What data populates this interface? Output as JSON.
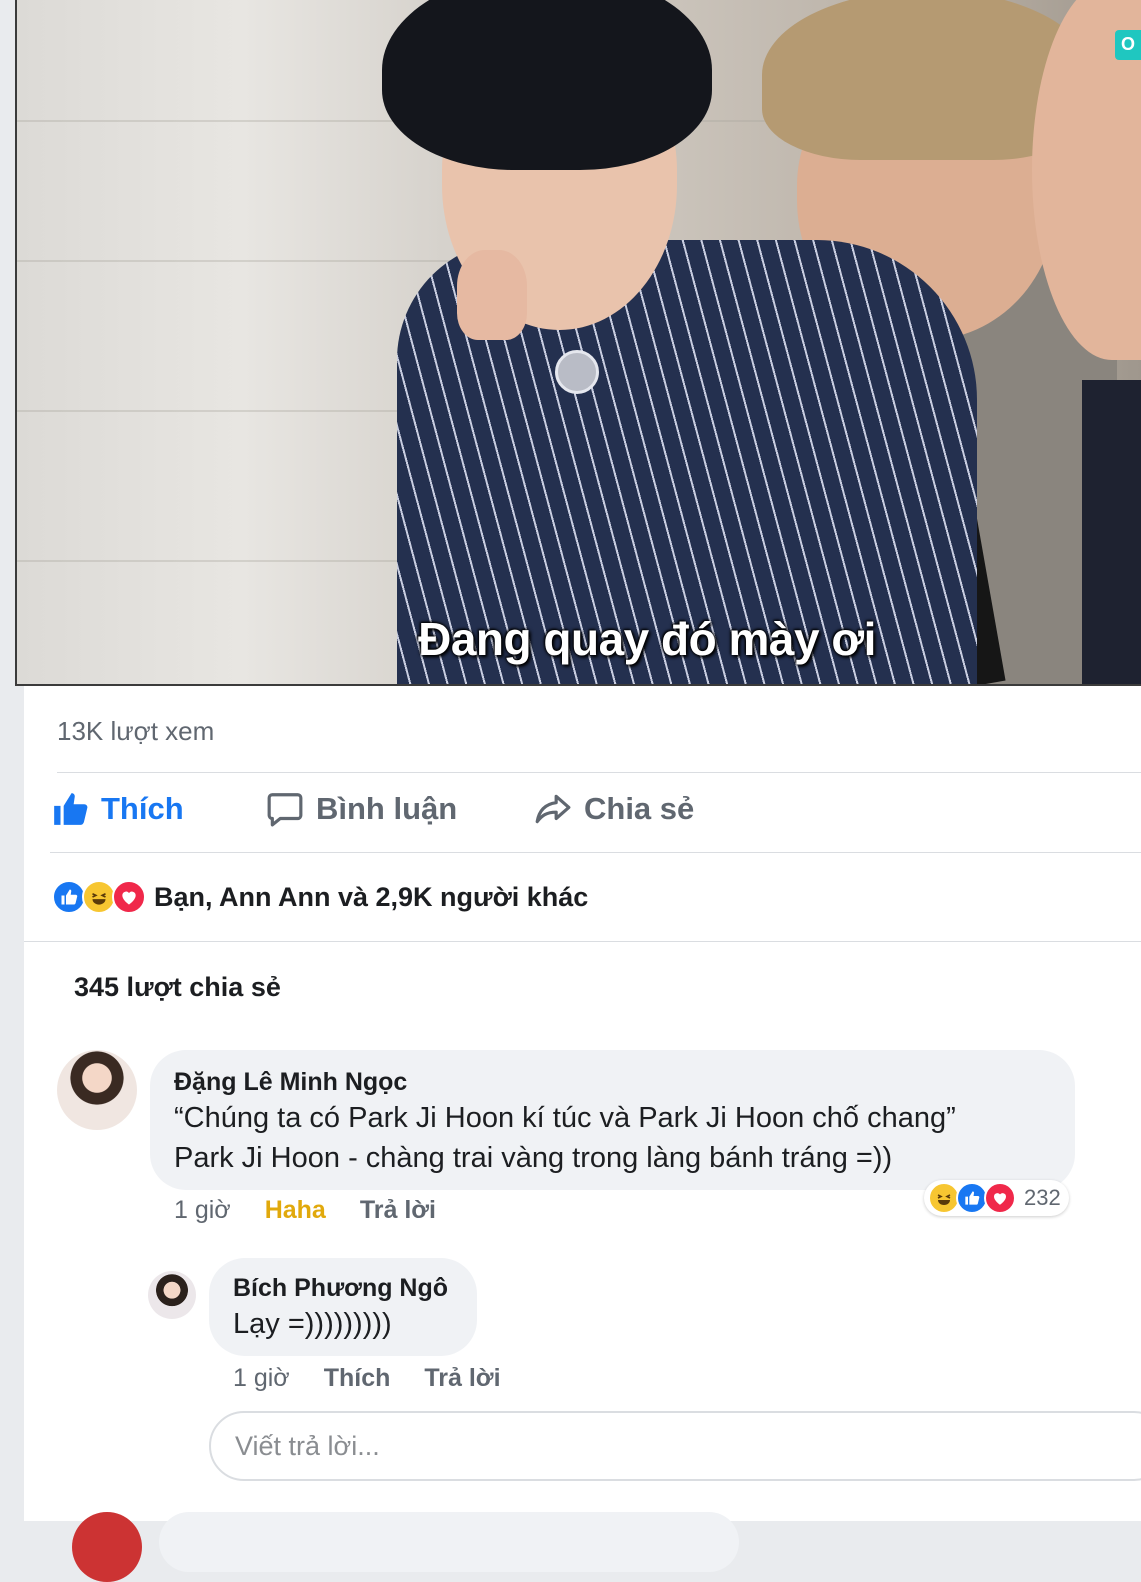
{
  "video": {
    "subtitle": "Đang quay đó mày ơi",
    "logo_text": "O"
  },
  "post": {
    "view_count": "13K lượt xem",
    "actions": {
      "like_label": "Thích",
      "comment_label": "Bình luận",
      "share_label": "Chia sẻ"
    },
    "reactions": {
      "icons": [
        "like-icon",
        "haha-icon",
        "love-icon"
      ],
      "summary": "Bạn, Ann Ann và 2,9K người khác"
    },
    "shares_count": "345 lượt chia sẻ",
    "accent_color": "#1877f2"
  },
  "comments": [
    {
      "author": "Đặng Lê Minh Ngọc",
      "lines": [
        "“Chúng ta có Park Ji Hoon kí túc và Park Ji Hoon chố chang”",
        "Park Ji Hoon - chàng trai vàng trong làng bánh tráng =))"
      ],
      "time": "1 giờ",
      "reaction_label": "Haha",
      "reply_label": "Trả lời",
      "reaction_icons": [
        "haha-icon",
        "like-icon",
        "love-icon"
      ],
      "reaction_count": "232"
    },
    {
      "author": "Bích Phương Ngô",
      "lines": [
        "Lạy =)))))))))"
      ],
      "time": "1 giờ",
      "like_label": "Thích",
      "reply_label": "Trả lời"
    }
  ],
  "reply_box": {
    "placeholder": "Viết trả lời..."
  }
}
